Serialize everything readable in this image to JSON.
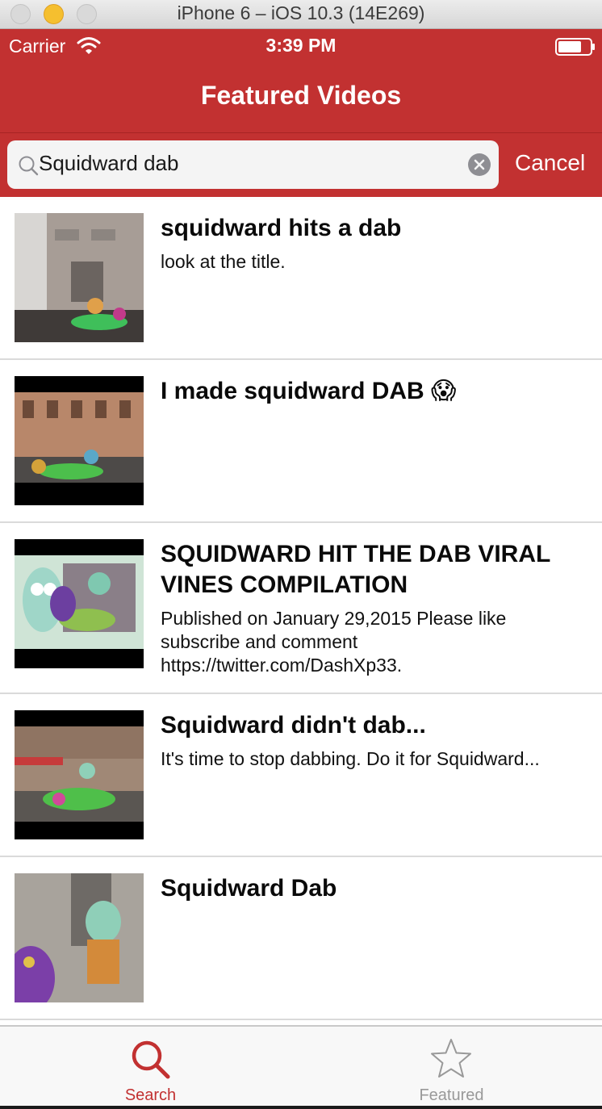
{
  "simulator": {
    "title": "iPhone 6 – iOS 10.3 (14E269)"
  },
  "status_bar": {
    "carrier": "Carrier",
    "time": "3:39 PM"
  },
  "nav": {
    "title": "Featured Videos"
  },
  "search": {
    "value": "Squidward dab",
    "placeholder": "Search",
    "cancel_label": "Cancel"
  },
  "results": [
    {
      "title": "squidward hits a dab",
      "description": "look at the title."
    },
    {
      "title": "I made squidward DAB 😱",
      "description": ""
    },
    {
      "title": "SQUIDWARD HIT THE DAB VIRAL VINES COMPILATION",
      "description": "Published on January 29,2015 Please like subscribe and comment https://twitter.com/DashXp33."
    },
    {
      "title": "Squidward didn't dab...",
      "description": "It's time to stop dabbing. Do it for Squidward..."
    },
    {
      "title": "Squidward Dab",
      "description": ""
    }
  ],
  "tabs": [
    {
      "label": "Search",
      "icon": "search-icon",
      "active": true
    },
    {
      "label": "Featured",
      "icon": "star-icon",
      "active": false
    }
  ],
  "colors": {
    "brand_red": "#c23131",
    "tab_inactive": "#999999"
  }
}
